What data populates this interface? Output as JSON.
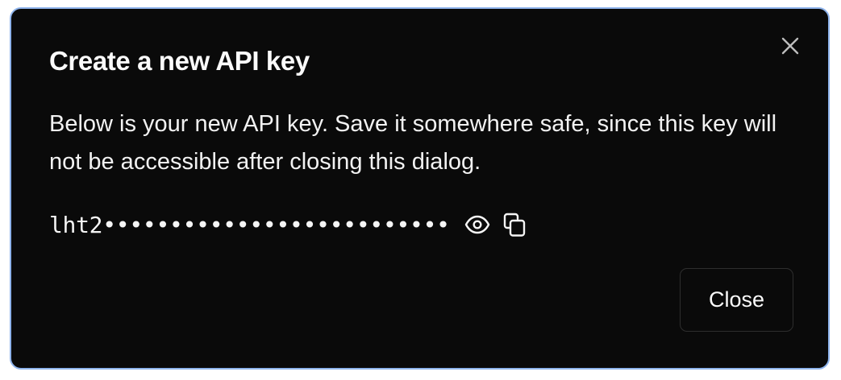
{
  "dialog": {
    "title": "Create a new API key",
    "description": "Below is your new API key. Save it somewhere safe, since this key will not be accessible after closing this dialog.",
    "api_key": {
      "prefix": "lht2",
      "masked": "••••••••••••••••••••••••••",
      "show_icon": "eye-icon",
      "copy_icon": "copy-icon"
    },
    "close_icon": "close-icon",
    "close_button_label": "Close"
  },
  "colors": {
    "background": "#0a0a0a",
    "border_accent": "#8fb4ec",
    "text": "#fafafa",
    "button_border": "#2e2e2e"
  }
}
